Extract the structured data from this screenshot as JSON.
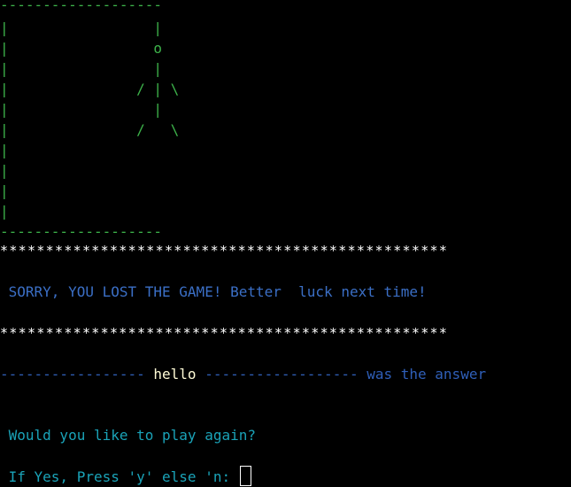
{
  "hangman": {
    "top_bar": "-------------------",
    "rows": [
      "|                 |",
      "|                 o",
      "|                 |",
      "|               / | \\",
      "|                 |",
      "|               /   \\",
      "|",
      "|",
      "|",
      "|"
    ],
    "bottom_bar": "-------------------"
  },
  "separator_top": "*************************************************",
  "result_message": " SORRY, YOU LOST THE GAME! Better  luck next time!",
  "separator_bottom": "*************************************************",
  "answer_line": {
    "left_dashes": "----------------- ",
    "word": "hello",
    "right_dashes": " ------------------",
    "suffix": " was the answer"
  },
  "prompt_play_again": " Would you like to play again?",
  "prompt_input": " If Yes, Press 'y' else 'n: ",
  "colors": {
    "gallows": "#3db34a",
    "stars": "#ffffff",
    "message": "#3b6fc6",
    "prompt": "#1aa3b8",
    "answer_word": "#fffbd6"
  }
}
